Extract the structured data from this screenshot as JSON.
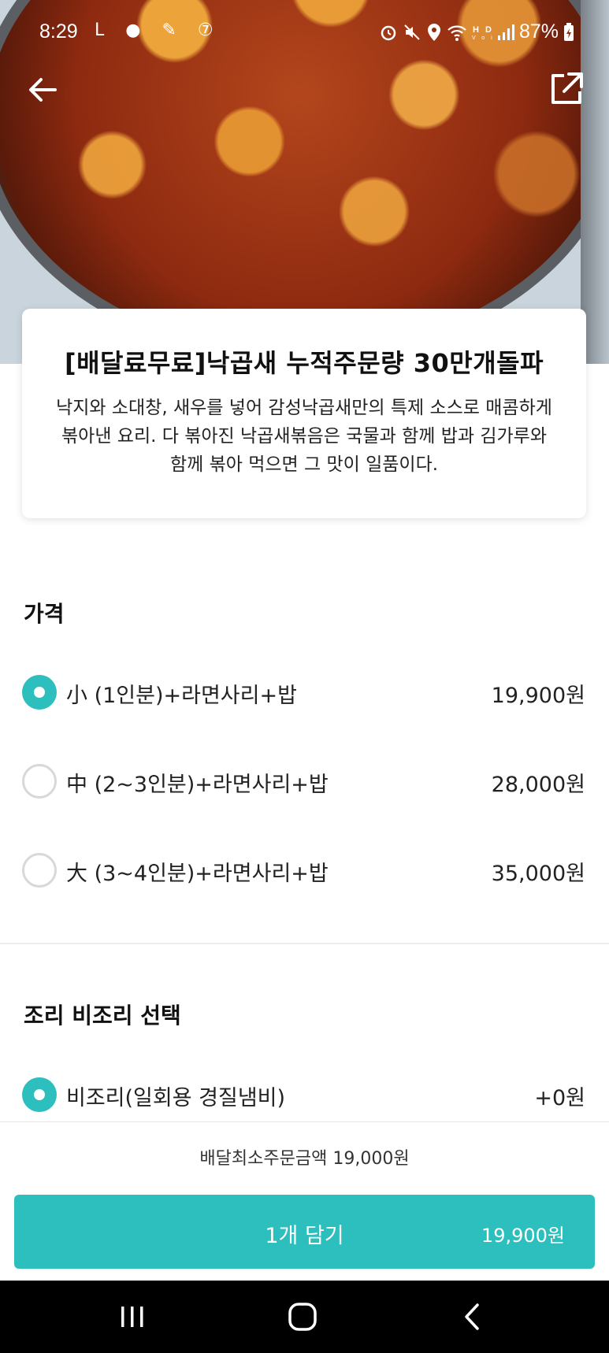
{
  "status_bar": {
    "time": "8:29",
    "left_icons": [
      "L",
      "●",
      "✎",
      "⑦"
    ],
    "right_icons": [
      "alarm-icon",
      "mute-icon",
      "location-icon",
      "wifi-icon",
      "hd-voice-icon",
      "signal-icon"
    ],
    "battery": "87%"
  },
  "hero": {
    "image": "food-photo",
    "back_icon": "arrow-left-icon",
    "share_icon": "share-external-icon"
  },
  "menu": {
    "title": "[배달료무료]낙곱새 누적주문량 30만개돌파",
    "description": "낙지와 소대창, 새우를 넣어 감성낙곱새만의 특제 소스로 매콤하게 볶아낸 요리. 다 볶아진 낙곱새볶음은 국물과 함께 밥과 김가루와 함께 볶아 먹으면 그 맛이 일품이다."
  },
  "price_section": {
    "title": "가격",
    "options": [
      {
        "label": "小 (1인분)+라면사리+밥",
        "price": "19,900원",
        "selected": true
      },
      {
        "label": "中 (2~3인분)+라면사리+밥",
        "price": "28,000원",
        "selected": false
      },
      {
        "label": "大 (3~4인분)+라면사리+밥",
        "price": "35,000원",
        "selected": false
      }
    ]
  },
  "cooking_section": {
    "title": "조리 비조리 선택",
    "options": [
      {
        "label": "비조리(일회용 경질냄비)",
        "price": "+0원",
        "selected": true
      }
    ]
  },
  "footer": {
    "min_order": "배달최소주문금액 19,000원",
    "cart_label": "1개 담기",
    "cart_price": "19,900원"
  },
  "colors": {
    "accent": "#2dbfbd",
    "nav_bar": "#000000"
  },
  "navigation": [
    "recent-apps-icon",
    "home-icon",
    "back-icon"
  ]
}
